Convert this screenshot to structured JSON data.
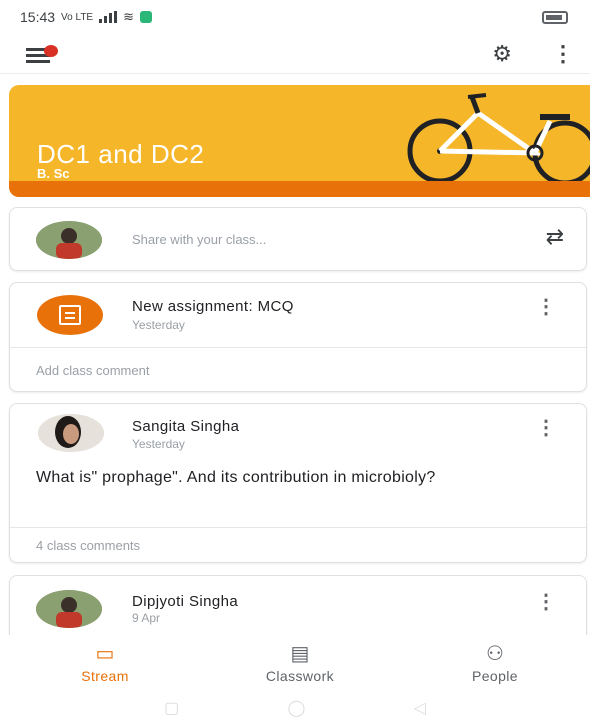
{
  "status_bar": {
    "time": "15:43",
    "network": "Vo LTE",
    "wifi": "≋",
    "battery": ""
  },
  "app_bar": {
    "menu_icon": "menu-icon",
    "settings_icon": "gear-icon",
    "more_icon": "more-vert-icon"
  },
  "banner": {
    "class_name": "DC1 and DC2",
    "section": "B. Sc",
    "color": "#f6b629",
    "stripe_color": "#e8710a"
  },
  "share": {
    "placeholder": "Share with your class...",
    "repost_icon": "repost-icon"
  },
  "posts": [
    {
      "title": "New assignment: MCQ",
      "time": "Yesterday",
      "comment_link": "Add class comment",
      "icon": "assignment-icon"
    },
    {
      "author": "Sangita Singha",
      "time": "Yesterday",
      "body": "What is\" prophage\". And its contribution in microbioly?",
      "comment_link": "4 class comments"
    },
    {
      "author": "Dipjyoti Singha",
      "time": "9 Apr"
    }
  ],
  "bottom_nav": [
    {
      "label": "Stream",
      "icon": "stream-icon",
      "active": true
    },
    {
      "label": "Classwork",
      "icon": "classwork-icon",
      "active": false
    },
    {
      "label": "People",
      "icon": "people-icon",
      "active": false
    }
  ],
  "colors": {
    "accent": "#e8710a",
    "banner": "#f6b629"
  }
}
